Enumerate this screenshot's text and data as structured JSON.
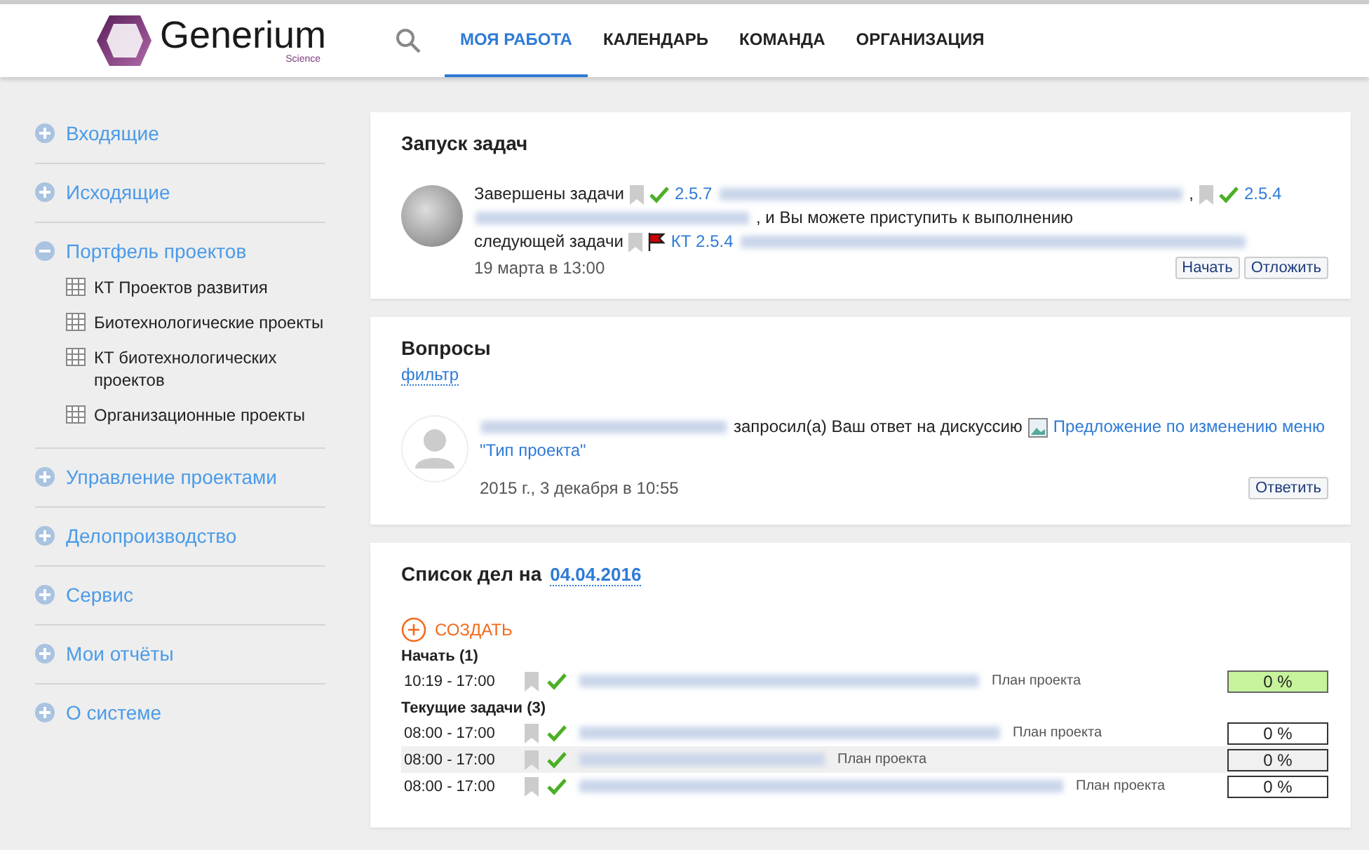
{
  "header": {
    "logo": {
      "name": "Generium",
      "tagline": "Science"
    },
    "nav": [
      {
        "label": "МОЯ РАБОТА",
        "selected": true
      },
      {
        "label": "КАЛЕНДАРЬ",
        "selected": false
      },
      {
        "label": "КОМАНДА",
        "selected": false
      },
      {
        "label": "ОРГАНИЗАЦИЯ",
        "selected": false
      }
    ]
  },
  "sidebar": {
    "items": [
      {
        "label": "Входящие",
        "expanded": false
      },
      {
        "label": "Исходящие",
        "expanded": false
      },
      {
        "label": "Портфель проектов",
        "expanded": true,
        "children": [
          {
            "label": "КТ Проектов развития"
          },
          {
            "label": "Биотехнологические проекты"
          },
          {
            "label": "КТ биотехнологических проектов"
          },
          {
            "label": "Организационные проекты"
          }
        ]
      },
      {
        "label": "Управление проектами",
        "expanded": false
      },
      {
        "label": "Делопроизводство",
        "expanded": false
      },
      {
        "label": "Сервис",
        "expanded": false
      },
      {
        "label": "Мои отчёты",
        "expanded": false
      },
      {
        "label": "О системе",
        "expanded": false
      }
    ]
  },
  "launch": {
    "title": "Запуск задач",
    "text_1": "Завершены задачи",
    "task_1": "2.5.7",
    "comma": ",",
    "task_2": "2.5.4",
    "text_2": ", и Вы можете приступить к выполнению",
    "text_3": "следующей задачи",
    "task_3": "КТ 2.5.4",
    "time": "19 марта в 13:00",
    "buttons": [
      "Начать",
      "Отложить"
    ]
  },
  "questions": {
    "title": "Вопросы",
    "filter": "фильтр",
    "text": "запросил(а) Ваш ответ на дискуссию",
    "link": [
      "Предложение по изменению меню",
      "\"Тип проекта\""
    ],
    "time": "2015 г., 3 декабря в 10:55",
    "button": "Ответить"
  },
  "todo": {
    "title": "Список дел на",
    "date": "04.04.2016",
    "create": "СОЗДАТЬ",
    "groups": [
      {
        "title": "Начать (1)",
        "rows": [
          {
            "time": "10:19 - 17:00",
            "source": "План проекта",
            "progress": "0 %",
            "started": true,
            "selected": false
          }
        ]
      },
      {
        "title": "Текущие задачи (3)",
        "rows": [
          {
            "time": "08:00 - 17:00",
            "source": "План проекта",
            "progress": "0 %",
            "started": false,
            "selected": false
          },
          {
            "time": "08:00 - 17:00",
            "source": "План проекта",
            "progress": "0 %",
            "started": false,
            "selected": true
          },
          {
            "time": "08:00 - 17:00",
            "source": "План проекта",
            "progress": "0 %",
            "started": false,
            "selected": false
          }
        ]
      }
    ]
  }
}
